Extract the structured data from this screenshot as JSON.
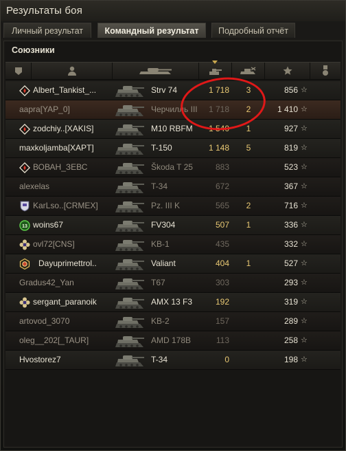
{
  "window": {
    "title": "Результаты боя"
  },
  "tabs": [
    {
      "label": "Личный результат",
      "active": false
    },
    {
      "label": "Командный результат",
      "active": true
    },
    {
      "label": "Подробный отчёт",
      "active": false
    }
  ],
  "section": {
    "title": "Союзники"
  },
  "columns": [
    {
      "icon": "platoon-icon"
    },
    {
      "icon": "player-icon"
    },
    {
      "icon": "tank-icon"
    },
    {
      "icon": "damage-icon",
      "sorted": true
    },
    {
      "icon": "kills-icon"
    },
    {
      "icon": "experience-star-icon"
    },
    {
      "icon": "medal-icon"
    }
  ],
  "players": [
    {
      "name": "Albert_Tankist_...",
      "tank": "Strv 74",
      "damage": "1 718",
      "kills": "3",
      "xp": "856",
      "alive": true,
      "badge": "diamond"
    },
    {
      "name": "aapra[YAP_0]",
      "tank": "Черчилль III",
      "damage": "1 718",
      "kills": "2",
      "xp": "1 410",
      "alive": false,
      "highlight": true
    },
    {
      "name": "zodchiy..[XAKIS]",
      "tank": "M10 RBFM",
      "damage": "1 540",
      "kills": "1",
      "xp": "927",
      "alive": true,
      "badge": "diamond"
    },
    {
      "name": "maxkoljamba[XAPT]",
      "tank": "T-150",
      "damage": "1 148",
      "kills": "5",
      "xp": "819",
      "alive": true
    },
    {
      "name": "ВОВАН_ЗЕВС",
      "tank": "Škoda T 25",
      "damage": "883",
      "kills": "",
      "xp": "523",
      "alive": false,
      "badge": "diamond"
    },
    {
      "name": "alexelas",
      "tank": "T-34",
      "damage": "672",
      "kills": "",
      "xp": "367",
      "alive": false
    },
    {
      "name": "KarLso..[CRMEX]",
      "tank": "Pz. III K",
      "damage": "565",
      "kills": "2",
      "xp": "716",
      "alive": false,
      "badge": "clan"
    },
    {
      "name": "woins67",
      "tank": "FV304",
      "damage": "507",
      "kills": "1",
      "xp": "336",
      "alive": true,
      "badge": "13"
    },
    {
      "name": "ovl72[CNS]",
      "tank": "KB-1",
      "damage": "435",
      "kills": "",
      "xp": "332",
      "alive": false,
      "badge": "flower"
    },
    {
      "name": "Dayuprimettrol..",
      "tank": "Valiant",
      "damage": "404",
      "kills": "1",
      "xp": "527",
      "alive": true,
      "badge": "hexagon"
    },
    {
      "name": "Gradus42_Yan",
      "tank": "T67",
      "damage": "303",
      "kills": "",
      "xp": "293",
      "alive": false
    },
    {
      "name": "sergant_paranoik",
      "tank": "AMX 13 F3",
      "damage": "192",
      "kills": "",
      "xp": "319",
      "alive": true,
      "badge": "flower"
    },
    {
      "name": "artovod_3070",
      "tank": "KB-2",
      "damage": "157",
      "kills": "",
      "xp": "289",
      "alive": false
    },
    {
      "name": "oleg__202[_TAUR]",
      "tank": "AMD 178B",
      "damage": "113",
      "kills": "",
      "xp": "258",
      "alive": false
    },
    {
      "name": "Hvostorez7",
      "tank": "T-34",
      "damage": "0",
      "kills": "",
      "xp": "198",
      "alive": true
    }
  ],
  "colors": {
    "accent": "#e8c873",
    "highlight_row": "#3c2a20",
    "annotation": "#e01818"
  }
}
